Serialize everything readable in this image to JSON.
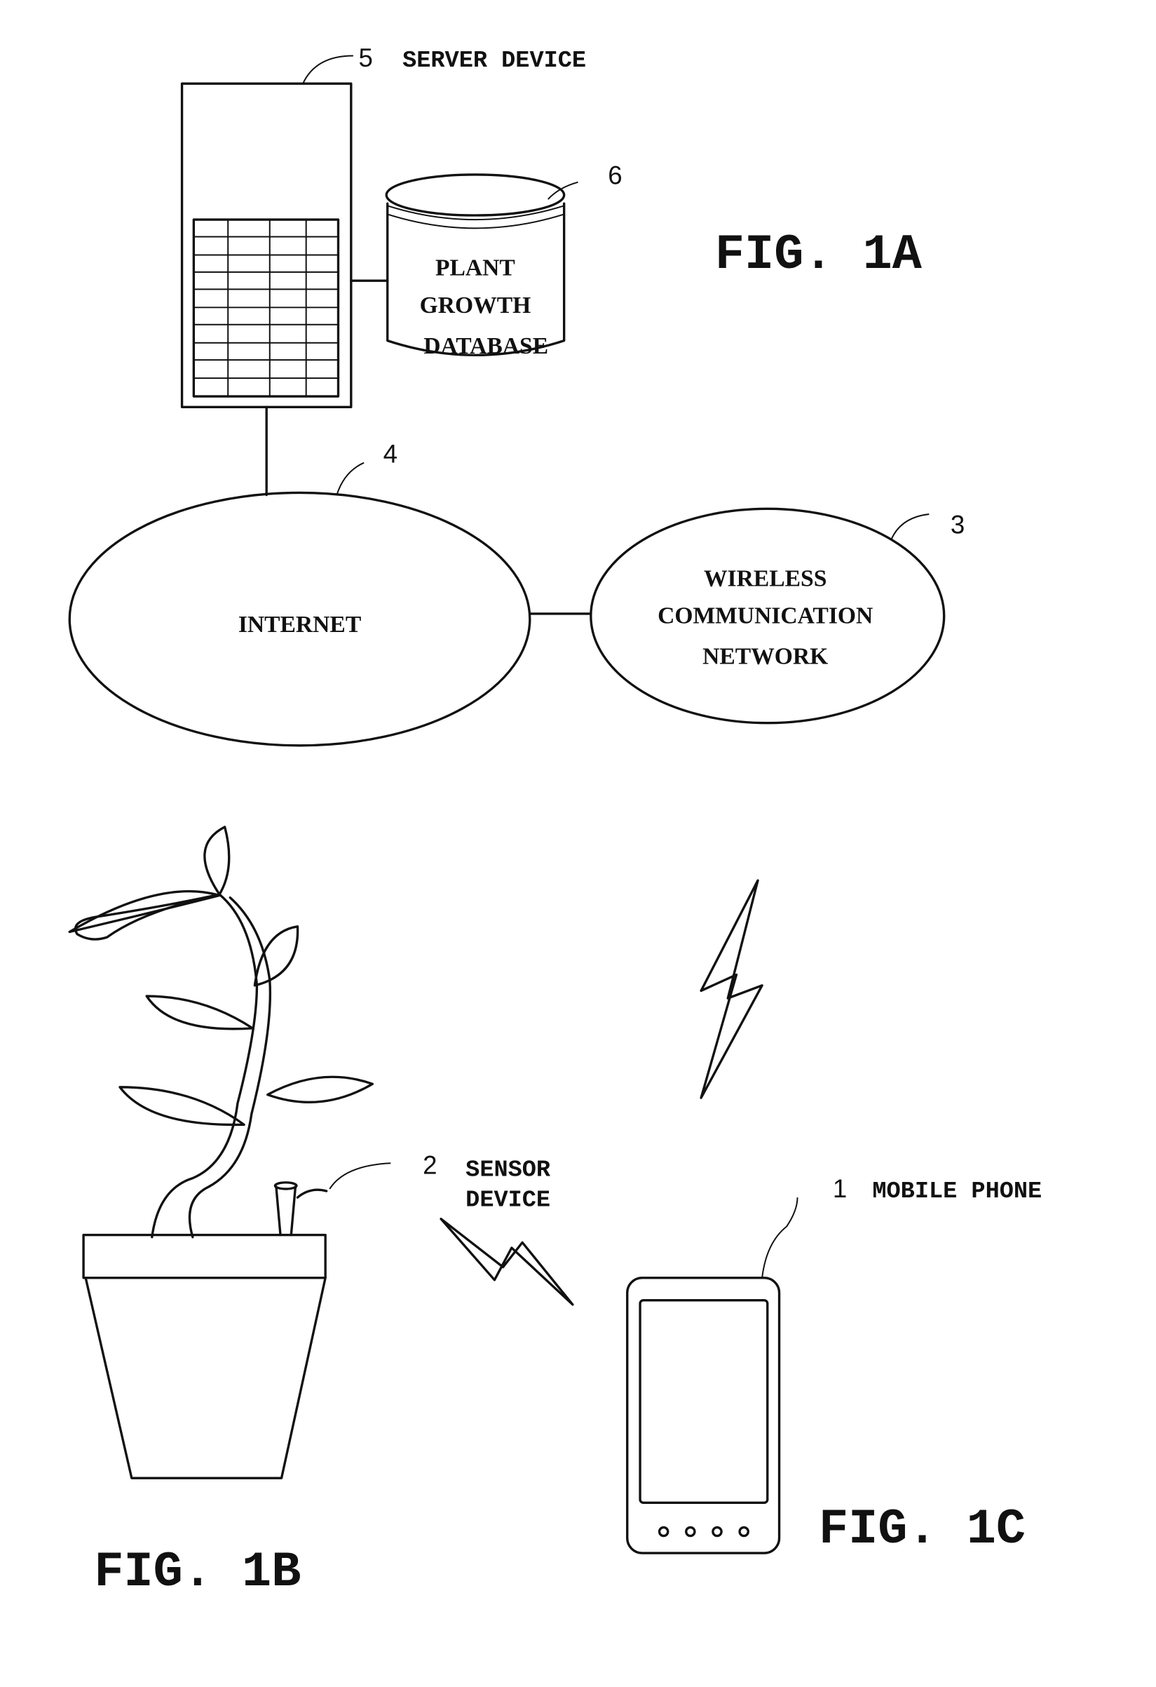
{
  "figures": {
    "fig1a": "FIG. 1A",
    "fig1b": "FIG. 1B",
    "fig1c": "FIG. 1C"
  },
  "server": {
    "ref": "5",
    "label": "SERVER DEVICE"
  },
  "database": {
    "ref": "6",
    "lines": [
      "PLANT",
      "GROWTH",
      "DATABASE"
    ]
  },
  "internet": {
    "ref": "4",
    "label": "INTERNET"
  },
  "wireless_network": {
    "ref": "3",
    "lines": [
      "WIRELESS",
      "COMMUNICATION",
      "NETWORK"
    ]
  },
  "sensor": {
    "ref": "2",
    "lines": [
      "SENSOR",
      "DEVICE"
    ]
  },
  "phone": {
    "ref": "1",
    "label": "MOBILE PHONE"
  },
  "line_color": "#111111"
}
